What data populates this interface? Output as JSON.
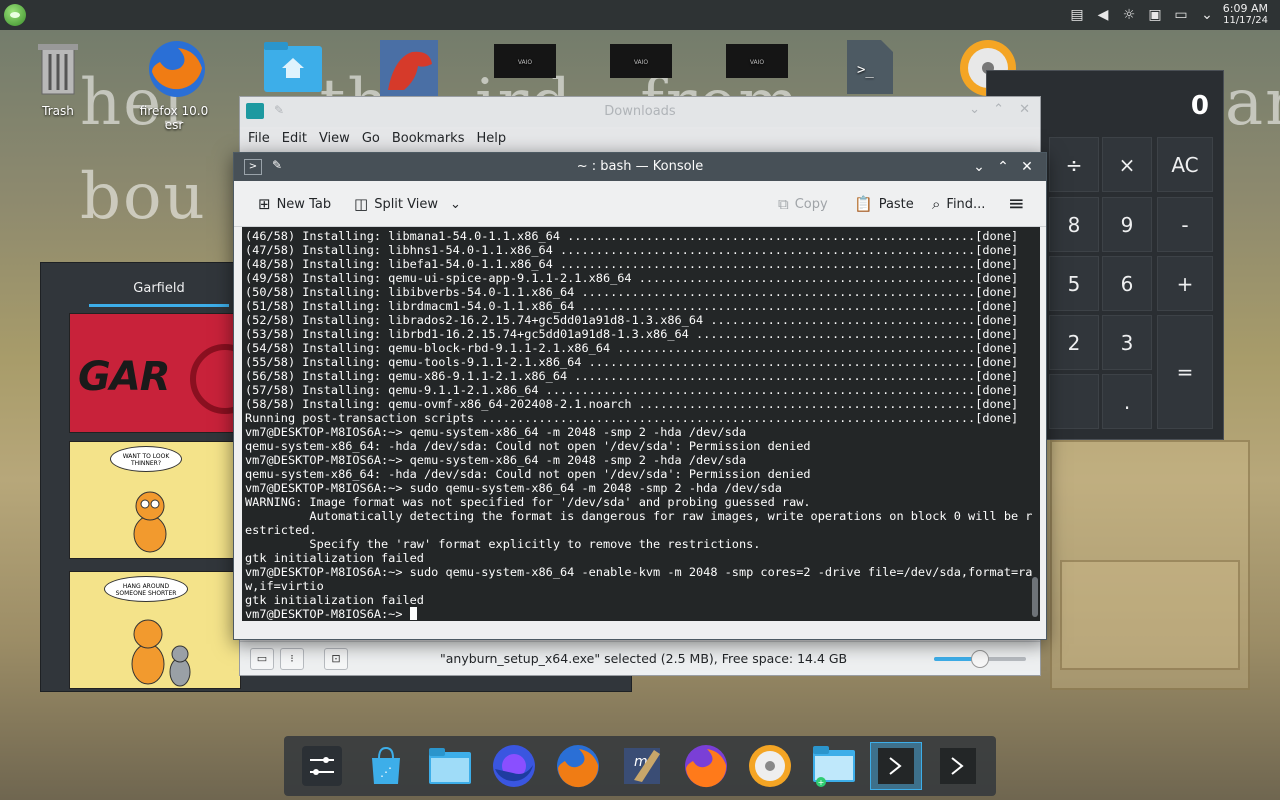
{
  "top_panel": {
    "launcher_icon": "opensuse-gecko-icon",
    "tray_icons": [
      "clipboard-icon",
      "volume-muted-icon",
      "brightness-icon",
      "storage-icon",
      "network-icon",
      "chevron-down-icon"
    ],
    "clock_time": "6:09 AM",
    "clock_date": "11/17/24"
  },
  "desktop_icons": [
    {
      "label": "Trash",
      "icon": "trash-icon"
    },
    {
      "label": "firefox 10.0 esr",
      "icon": "firefox-icon"
    },
    {
      "label": "",
      "icon": "home-folder-icon"
    },
    {
      "label": "",
      "icon": "dinosaur-app-icon"
    },
    {
      "label": "",
      "icon": "video-thumbnail-icon"
    },
    {
      "label": "",
      "icon": "video-thumbnail-icon"
    },
    {
      "label": "",
      "icon": "video-thumbnail-icon"
    },
    {
      "label": "",
      "icon": "terminal-icon"
    },
    {
      "label": "",
      "icon": "disc-burner-icon"
    }
  ],
  "calculator": {
    "display": "0",
    "keys": [
      "÷",
      "×",
      "AC",
      "8",
      "9",
      "-",
      "5",
      "6",
      "+",
      "2",
      "3",
      "=",
      "."
    ]
  },
  "garfield": {
    "tab": "Garfield",
    "panel1_text": "WANT TO LOOK THINNER?",
    "panel2_text": "HANG AROUND SOMEONE SHORTER"
  },
  "dolphin": {
    "title": "Downloads",
    "menu": [
      "File",
      "Edit",
      "View",
      "Go",
      "Bookmarks",
      "Help"
    ],
    "status_text": "\"anyburn_setup_x64.exe\" selected (2.5 MB), Free space: 14.4 GB",
    "zoom_fraction": 0.5
  },
  "konsole": {
    "title": "~ : bash — Konsole",
    "toolbar": {
      "new_tab": "New Tab",
      "split_view": "Split View",
      "copy": "Copy",
      "paste": "Paste",
      "find": "Find..."
    },
    "lines": [
      "(46/58) Installing: libmana1-54.0-1.1.x86_64 .........................................................[done]",
      "(47/58) Installing: libhns1-54.0-1.1.x86_64 ..........................................................[done]",
      "(48/58) Installing: libefa1-54.0-1.1.x86_64 ..........................................................[done]",
      "(49/58) Installing: qemu-ui-spice-app-9.1.1-2.1.x86_64 ...............................................[done]",
      "(50/58) Installing: libibverbs-54.0-1.1.x86_64 .......................................................[done]",
      "(51/58) Installing: librdmacm1-54.0-1.1.x86_64 .......................................................[done]",
      "(52/58) Installing: librados2-16.2.15.74+gc5dd01a91d8-1.3.x86_64 .....................................[done]",
      "(53/58) Installing: librbd1-16.2.15.74+gc5dd01a91d8-1.3.x86_64 .......................................[done]",
      "(54/58) Installing: qemu-block-rbd-9.1.1-2.1.x86_64 ..................................................[done]",
      "(55/58) Installing: qemu-tools-9.1.1-2.1.x86_64 ......................................................[done]",
      "(56/58) Installing: qemu-x86-9.1.1-2.1.x86_64 ........................................................[done]",
      "(57/58) Installing: qemu-9.1.1-2.1.x86_64 ............................................................[done]",
      "(58/58) Installing: qemu-ovmf-x86_64-202408-2.1.noarch ...............................................[done]",
      "Running post-transaction scripts .....................................................................[done]",
      "vm7@DESKTOP-M8IOS6A:~> qemu-system-x86_64 -m 2048 -smp 2 -hda /dev/sda",
      "qemu-system-x86_64: -hda /dev/sda: Could not open '/dev/sda': Permission denied",
      "vm7@DESKTOP-M8IOS6A:~> qemu-system-x86_64 -m 2048 -smp 2 -hda /dev/sda",
      "qemu-system-x86_64: -hda /dev/sda: Could not open '/dev/sda': Permission denied",
      "vm7@DESKTOP-M8IOS6A:~> sudo qemu-system-x86_64 -m 2048 -smp 2 -hda /dev/sda",
      "WARNING: Image format was not specified for '/dev/sda' and probing guessed raw.",
      "         Automatically detecting the format is dangerous for raw images, write operations on block 0 will be r",
      "estricted.",
      "         Specify the 'raw' format explicitly to remove the restrictions.",
      "gtk initialization failed",
      "vm7@DESKTOP-M8IOS6A:~> sudo qemu-system-x86_64 -enable-kvm -m 2048 -smp cores=2 -drive file=/dev/sda,format=ra",
      "w,if=virtio",
      "gtk initialization failed"
    ],
    "prompt": "vm7@DESKTOP-M8IOS6A:~> "
  },
  "dock": [
    {
      "icon": "system-settings-icon"
    },
    {
      "icon": "discover-store-icon"
    },
    {
      "icon": "file-manager-icon"
    },
    {
      "icon": "firefox-nightly-icon"
    },
    {
      "icon": "firefox-icon"
    },
    {
      "icon": "kate-editor-icon"
    },
    {
      "icon": "firefox-icon"
    },
    {
      "icon": "disc-burner-icon"
    },
    {
      "icon": "downloads-folder-icon"
    },
    {
      "icon": "konsole-icon"
    },
    {
      "icon": "konsole-icon"
    }
  ],
  "colors": {
    "accent": "#3daee9",
    "terminal_bg": "#232627",
    "titlebar_active": "#475057"
  }
}
